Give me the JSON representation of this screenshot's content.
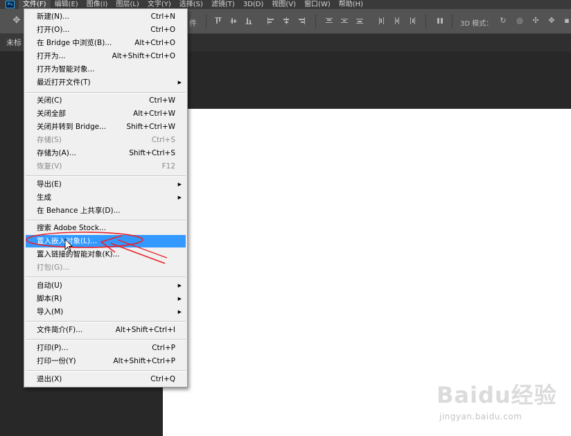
{
  "app": {
    "logo_text": "Ps"
  },
  "menubar": {
    "items": [
      "文件(F)",
      "编辑(E)",
      "图像(I)",
      "图层(L)",
      "文字(Y)",
      "选择(S)",
      "滤镜(T)",
      "3D(D)",
      "视图(V)",
      "窗口(W)",
      "帮助(H)"
    ],
    "active_index": 0
  },
  "options_bar": {
    "partial_label": "件",
    "mode_3d_label": "3D 模式："
  },
  "document_tab": {
    "label": "未标"
  },
  "file_menu": {
    "items": [
      {
        "label": "新建(N)...",
        "shortcut": "Ctrl+N"
      },
      {
        "label": "打开(O)...",
        "shortcut": "Ctrl+O"
      },
      {
        "label": "在 Bridge 中浏览(B)...",
        "shortcut": "Alt+Ctrl+O"
      },
      {
        "label": "打开为...",
        "shortcut": "Alt+Shift+Ctrl+O"
      },
      {
        "label": "打开为智能对象...",
        "shortcut": ""
      },
      {
        "label": "最近打开文件(T)",
        "shortcut": "",
        "submenu": true
      },
      {
        "label": "关闭(C)",
        "shortcut": "Ctrl+W"
      },
      {
        "label": "关闭全部",
        "shortcut": "Alt+Ctrl+W"
      },
      {
        "label": "关闭并转到 Bridge...",
        "shortcut": "Shift+Ctrl+W"
      },
      {
        "label": "存储(S)",
        "shortcut": "Ctrl+S",
        "disabled": true
      },
      {
        "label": "存储为(A)...",
        "shortcut": "Shift+Ctrl+S"
      },
      {
        "label": "恢复(V)",
        "shortcut": "F12",
        "disabled": true
      },
      {
        "label": "导出(E)",
        "shortcut": "",
        "submenu": true
      },
      {
        "label": "生成",
        "shortcut": "",
        "submenu": true
      },
      {
        "label": "在 Behance 上共享(D)...",
        "shortcut": ""
      },
      {
        "label": "搜索 Adobe Stock...",
        "shortcut": ""
      },
      {
        "label": "置入嵌入对象(L)...",
        "shortcut": "",
        "highlight": true
      },
      {
        "label": "置入链接的智能对象(K)...",
        "shortcut": ""
      },
      {
        "label": "打包(G)...",
        "shortcut": "",
        "disabled": true
      },
      {
        "label": "自动(U)",
        "shortcut": "",
        "submenu": true
      },
      {
        "label": "脚本(R)",
        "shortcut": "",
        "submenu": true
      },
      {
        "label": "导入(M)",
        "shortcut": "",
        "submenu": true
      },
      {
        "label": "文件简介(F)...",
        "shortcut": "Alt+Shift+Ctrl+I"
      },
      {
        "label": "打印(P)...",
        "shortcut": "Ctrl+P"
      },
      {
        "label": "打印一份(Y)",
        "shortcut": "Alt+Shift+Ctrl+P"
      },
      {
        "label": "退出(X)",
        "shortcut": "Ctrl+Q"
      }
    ],
    "submenu_glyph": "▶"
  },
  "watermark": {
    "brand": "Baidu经验",
    "url": "jingyan.baidu.com"
  },
  "colors": {
    "highlight": "#3399ff",
    "annotation": "#e8202a",
    "menu_bg": "#f0f0f0",
    "canvas": "#ffffff"
  }
}
